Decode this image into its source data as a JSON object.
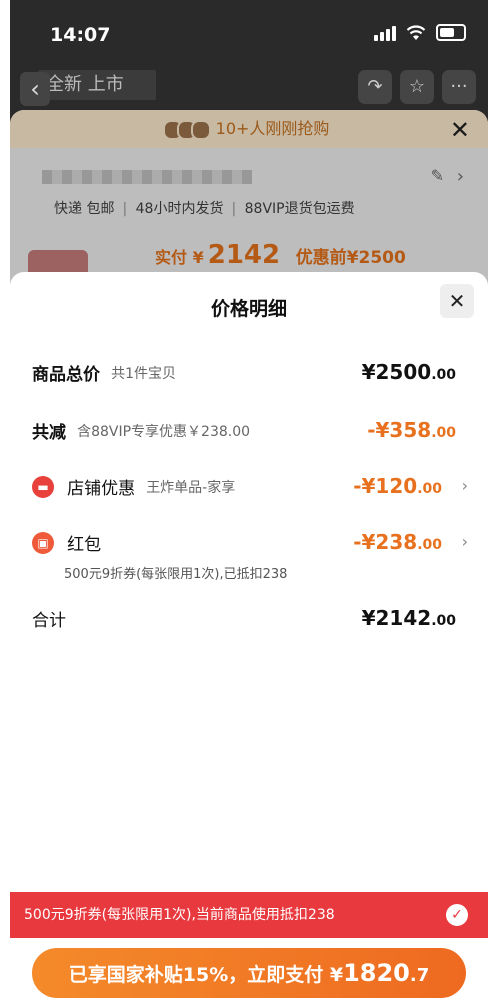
{
  "status": {
    "time": "14:07"
  },
  "nav": {
    "title": "全新 上市",
    "back_icon": "‹",
    "share_icon": "↷",
    "star_icon": "☆",
    "more_icon": "···"
  },
  "sheet": {
    "buyers_text": "10+人刚刚抢购",
    "close_icon": "✕",
    "tags": [
      "快递 包邮",
      "48小时内发货",
      "88VIP退货包运费"
    ],
    "price_label": "实付",
    "price_currency": "¥",
    "price_value": "2142",
    "price_before": "优惠前¥2500"
  },
  "detail": {
    "title": "价格明细",
    "close_icon": "✕",
    "total": {
      "label": "商品总价",
      "sub": "共1件宝贝",
      "amount": "¥2500",
      "decimals": ".00"
    },
    "reduce": {
      "label": "共减",
      "sub": "含88VIP专享优惠￥238.00",
      "amount": "-¥358",
      "decimals": ".00"
    },
    "store": {
      "label": "店铺优惠",
      "sub": "王炸单品-家享",
      "amount": "-¥120",
      "decimals": ".00"
    },
    "redpack": {
      "label": "红包",
      "note": "500元9折券(每张限用1次),已抵扣238",
      "amount": "-¥238",
      "decimals": ".00"
    },
    "sum": {
      "label": "合计",
      "amount": "¥2142",
      "decimals": ".00"
    }
  },
  "banner": {
    "text": "500元9折券(每张限用1次),当前商品使用抵扣238",
    "check_icon": "✓"
  },
  "pay": {
    "prefix": "已享国家补贴15%，立即支付 ¥",
    "amount_int": "1820",
    "amount_dec": ".7"
  },
  "colors": {
    "accent": "#e7711e",
    "red": "#e8393f",
    "button": "#f07a26"
  }
}
